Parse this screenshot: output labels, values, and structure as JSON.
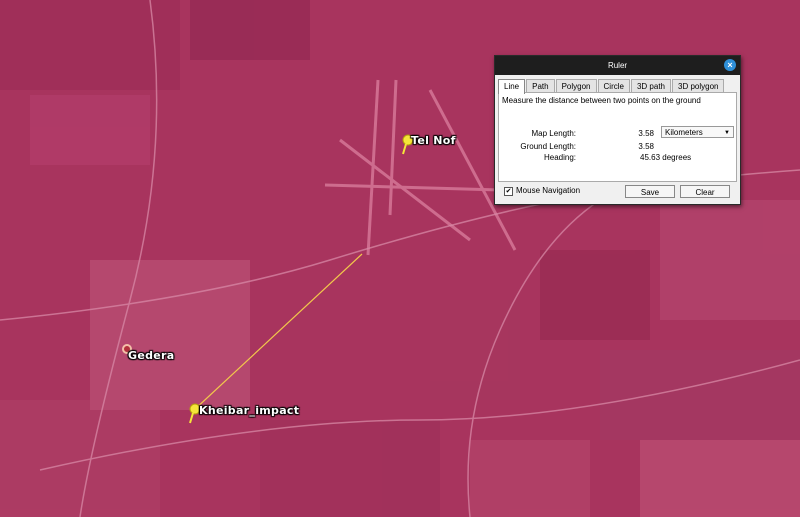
{
  "map": {
    "background_color": "#a8345e",
    "measure_line_color": "#f2c84b",
    "places": {
      "tel_nof": "Tel Nof",
      "gedera": "Gedera",
      "kheibar_impact": "Kheibar_impact"
    }
  },
  "ruler": {
    "title": "Ruler",
    "tabs": [
      "Line",
      "Path",
      "Polygon",
      "Circle",
      "3D path",
      "3D polygon"
    ],
    "active_tab": "Line",
    "description": "Measure the distance between two points on the ground",
    "map_length_label": "Map Length:",
    "map_length_value": "3.58",
    "unit": "Kilometers",
    "ground_length_label": "Ground Length:",
    "ground_length_value": "3.58",
    "heading_label": "Heading:",
    "heading_value": "45.63 degrees",
    "mouse_nav_label": "Mouse Navigation",
    "mouse_nav_checked": true,
    "save_label": "Save",
    "clear_label": "Clear"
  }
}
